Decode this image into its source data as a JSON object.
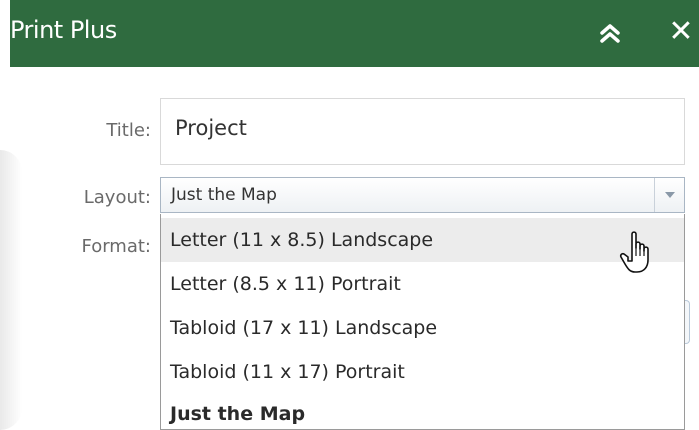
{
  "header": {
    "title": "Print Plus",
    "collapse_icon": "double-chevron-up-icon",
    "close_label": "✕",
    "close_icon": "close-icon",
    "background_color": "#2f6b3f"
  },
  "form": {
    "title_label": "Title:",
    "title_value": "Project",
    "layout_label": "Layout:",
    "layout_value": "Just the Map",
    "format_label": "Format:"
  },
  "layout_options": [
    {
      "label": "Letter (11 x 8.5) Landscape",
      "highlighted": true
    },
    {
      "label": "Letter (8.5 x 11) Portrait"
    },
    {
      "label": "Tabloid (17 x 11) Landscape"
    },
    {
      "label": "Tabloid (11 x 17) Portrait"
    },
    {
      "label": "Just the Map",
      "selected": true
    }
  ],
  "cursor": "hand-pointer-icon"
}
